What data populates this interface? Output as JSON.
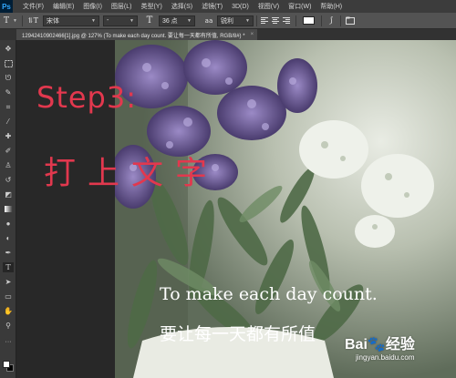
{
  "app": {
    "logo": "Ps"
  },
  "menu": [
    "文件(F)",
    "编辑(E)",
    "图像(I)",
    "图层(L)",
    "类型(Y)",
    "选择(S)",
    "滤镜(T)",
    "3D(D)",
    "视图(V)",
    "窗口(W)",
    "帮助(H)"
  ],
  "options": {
    "tool_icon": "T",
    "orient_icon": "⥮T",
    "font_family": "宋体",
    "font_style": "-",
    "size_icon": "T",
    "font_size": "36 点",
    "aa_icon": "aa",
    "antialias": "锐利",
    "text_color": "#ffffff"
  },
  "document": {
    "tab_title": "12942410902466[1].jpg @ 127% (To make each day count. 要让每一天都有所值, RGB/8#) *",
    "tab_close": "×"
  },
  "canvas": {
    "english_text": "To make each day count.",
    "chinese_text": "要让每一天都有所值"
  },
  "annotation": {
    "step": "Step3:",
    "instruction": "打上文字",
    "color": "#e2384e"
  },
  "watermark": {
    "brand": "Bai🐾经验",
    "url": "jingyan.baidu.com"
  },
  "toolbar_tools": [
    "move-tool",
    "marquee-tool",
    "lasso-tool",
    "quick-select-tool",
    "crop-tool",
    "eyedropper-tool",
    "healing-tool",
    "brush-tool",
    "stamp-tool",
    "history-brush-tool",
    "eraser-tool",
    "gradient-tool",
    "blur-tool",
    "dodge-tool",
    "pen-tool",
    "type-tool",
    "path-select-tool",
    "shape-tool",
    "hand-tool",
    "zoom-tool"
  ]
}
